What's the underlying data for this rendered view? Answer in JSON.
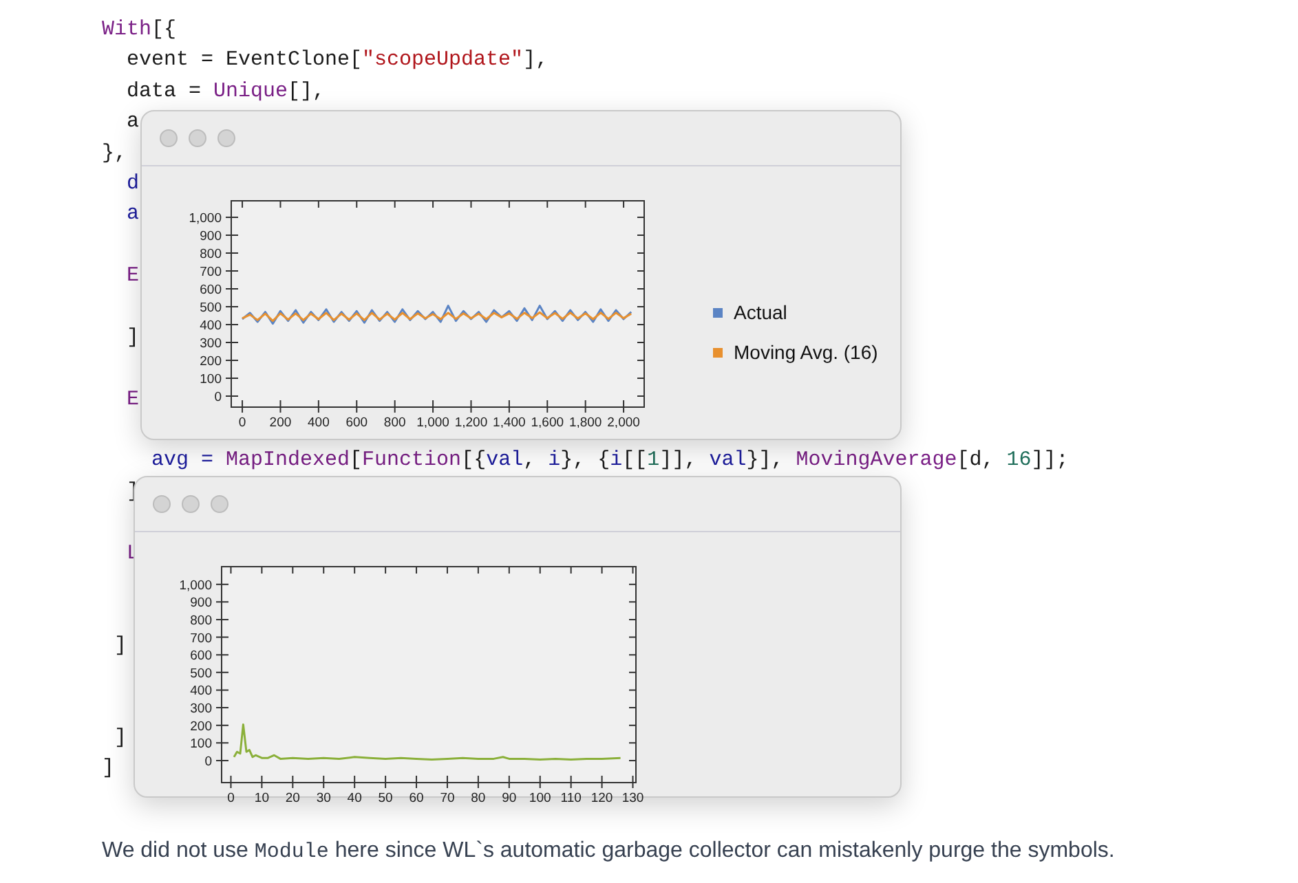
{
  "code_lines": [
    {
      "segments": [
        {
          "text": "With",
          "kind": "keyword"
        },
        {
          "text": "[{",
          "kind": "plain"
        }
      ]
    },
    {
      "segments": [
        {
          "text": "  event = EventClone[",
          "kind": "plain"
        },
        {
          "text": "\"scopeUpdate\"",
          "kind": "string"
        },
        {
          "text": "],",
          "kind": "plain"
        }
      ]
    },
    {
      "segments": [
        {
          "text": "  data = ",
          "kind": "plain"
        },
        {
          "text": "Unique",
          "kind": "keyword"
        },
        {
          "text": "[],",
          "kind": "plain"
        }
      ]
    },
    {
      "segments": [
        {
          "text": "  a",
          "kind": "plain"
        }
      ]
    },
    {
      "segments": [
        {
          "text": "},",
          "kind": "plain"
        }
      ]
    },
    {
      "segments": [
        {
          "text": "  d",
          "kind": "symbol"
        }
      ]
    },
    {
      "segments": [
        {
          "text": "  a",
          "kind": "symbol"
        }
      ]
    },
    {
      "segments": [
        {
          "text": "  E",
          "kind": "keyword"
        }
      ]
    },
    {
      "segments": [
        {
          "text": "  ]",
          "kind": "plain"
        }
      ]
    },
    {
      "segments": [
        {
          "text": "  E",
          "kind": "keyword"
        }
      ]
    },
    {
      "segments": [
        {
          "text": "    avg = ",
          "kind": "symbol"
        },
        {
          "text": "MapIndexed",
          "kind": "keyword"
        },
        {
          "text": "[",
          "kind": "plain"
        },
        {
          "text": "Function",
          "kind": "keyword"
        },
        {
          "text": "[{",
          "kind": "plain"
        },
        {
          "text": "val",
          "kind": "symbol"
        },
        {
          "text": ", ",
          "kind": "plain"
        },
        {
          "text": "i",
          "kind": "symbol"
        },
        {
          "text": "}, {",
          "kind": "plain"
        },
        {
          "text": "i",
          "kind": "symbol"
        },
        {
          "text": "[[",
          "kind": "plain"
        },
        {
          "text": "1",
          "kind": "number"
        },
        {
          "text": "]], ",
          "kind": "plain"
        },
        {
          "text": "val",
          "kind": "symbol"
        },
        {
          "text": "}], ",
          "kind": "plain"
        },
        {
          "text": "MovingAverage",
          "kind": "keyword"
        },
        {
          "text": "[d, ",
          "kind": "plain"
        },
        {
          "text": "16",
          "kind": "number"
        },
        {
          "text": "]];",
          "kind": "plain"
        }
      ]
    },
    {
      "segments": [
        {
          "text": "  ]",
          "kind": "plain"
        }
      ]
    },
    {
      "segments": [
        {
          "text": "  L",
          "kind": "keyword"
        }
      ]
    },
    {
      "segments": [
        {
          "text": " ]",
          "kind": "plain"
        }
      ]
    },
    {
      "segments": [
        {
          "text": " ]",
          "kind": "plain"
        }
      ]
    },
    {
      "segments": [
        {
          "text": "]",
          "kind": "plain"
        }
      ]
    }
  ],
  "windows": [
    {
      "chart_data": {
        "type": "line",
        "xlim": [
          -58,
          2108
        ],
        "ylim": [
          -62,
          1092
        ],
        "xticks": [
          {
            "value": 0,
            "label": "0"
          },
          {
            "value": 200,
            "label": "200"
          },
          {
            "value": 400,
            "label": "400"
          },
          {
            "value": 600,
            "label": "600"
          },
          {
            "value": 800,
            "label": "800"
          },
          {
            "value": 1000,
            "label": "1,000"
          },
          {
            "value": 1200,
            "label": "1,200"
          },
          {
            "value": 1400,
            "label": "1,400"
          },
          {
            "value": 1600,
            "label": "1,600"
          },
          {
            "value": 1800,
            "label": "1,800"
          },
          {
            "value": 2000,
            "label": "2,000"
          }
        ],
        "yticks": [
          {
            "value": 0,
            "label": "0"
          },
          {
            "value": 100,
            "label": "100"
          },
          {
            "value": 200,
            "label": "200"
          },
          {
            "value": 300,
            "label": "300"
          },
          {
            "value": 400,
            "label": "400"
          },
          {
            "value": 500,
            "label": "500"
          },
          {
            "value": 600,
            "label": "600"
          },
          {
            "value": 700,
            "label": "700"
          },
          {
            "value": 800,
            "label": "800"
          },
          {
            "value": 900,
            "label": "900"
          },
          {
            "value": 1000,
            "label": "1,000"
          }
        ],
        "x": [
          0,
          40,
          80,
          120,
          160,
          200,
          240,
          280,
          320,
          360,
          400,
          440,
          480,
          520,
          560,
          600,
          640,
          680,
          720,
          760,
          800,
          840,
          880,
          920,
          960,
          1000,
          1040,
          1080,
          1120,
          1160,
          1200,
          1240,
          1280,
          1320,
          1360,
          1400,
          1440,
          1480,
          1520,
          1560,
          1600,
          1640,
          1680,
          1720,
          1760,
          1800,
          1840,
          1880,
          1920,
          1960,
          2000,
          2040
        ],
        "series": [
          {
            "name": "Actual",
            "color": "#5b84c4",
            "values": [
              430,
              465,
              415,
              470,
              405,
              475,
              420,
              480,
              410,
              470,
              425,
              485,
              415,
              470,
              420,
              475,
              410,
              480,
              420,
              470,
              415,
              485,
              425,
              475,
              430,
              470,
              415,
              505,
              420,
              475,
              430,
              470,
              415,
              480,
              440,
              475,
              420,
              490,
              425,
              505,
              430,
              475,
              420,
              480,
              425,
              470,
              415,
              485,
              420,
              480,
              430,
              470
            ]
          },
          {
            "name": "Moving Avg. (16)",
            "color": "#e8902e",
            "values": [
              435,
              455,
              425,
              460,
              420,
              462,
              428,
              462,
              425,
              460,
              430,
              465,
              425,
              460,
              428,
              462,
              425,
              465,
              428,
              460,
              428,
              465,
              430,
              462,
              435,
              458,
              430,
              465,
              432,
              462,
              435,
              460,
              430,
              465,
              440,
              462,
              432,
              466,
              436,
              468,
              436,
              464,
              432,
              466,
              434,
              462,
              430,
              466,
              432,
              466,
              436,
              460
            ]
          }
        ]
      }
    },
    {
      "chart_data": {
        "type": "line",
        "xlim": [
          -3,
          131
        ],
        "ylim": [
          -125,
          1100
        ],
        "xticks": [
          0,
          10,
          20,
          30,
          40,
          50,
          60,
          70,
          80,
          90,
          100,
          110,
          120,
          130
        ],
        "yticks": [
          {
            "value": 0,
            "label": "0"
          },
          {
            "value": 100,
            "label": "100"
          },
          {
            "value": 200,
            "label": "200"
          },
          {
            "value": 300,
            "label": "300"
          },
          {
            "value": 400,
            "label": "400"
          },
          {
            "value": 500,
            "label": "500"
          },
          {
            "value": 600,
            "label": "600"
          },
          {
            "value": 700,
            "label": "700"
          },
          {
            "value": 800,
            "label": "800"
          },
          {
            "value": 900,
            "label": "900"
          },
          {
            "value": 1000,
            "label": "1,000"
          }
        ],
        "x": [
          1,
          2,
          3,
          4,
          5,
          6,
          7,
          8,
          10,
          12,
          14,
          16,
          20,
          25,
          30,
          35,
          40,
          45,
          50,
          55,
          60,
          65,
          70,
          75,
          80,
          85,
          88,
          90,
          95,
          100,
          105,
          110,
          115,
          120,
          126
        ],
        "series": [
          {
            "color": "#8bb03a",
            "values": [
              20,
              50,
              40,
              205,
              50,
              60,
              20,
              30,
              15,
              15,
              30,
              10,
              15,
              10,
              15,
              10,
              20,
              15,
              10,
              15,
              10,
              5,
              10,
              15,
              10,
              10,
              20,
              10,
              10,
              5,
              10,
              5,
              10,
              10,
              15
            ]
          }
        ]
      }
    }
  ],
  "paragraph": [
    {
      "text": "We did not use ",
      "kind": "plain"
    },
    {
      "text": "Module",
      "kind": "code"
    },
    {
      "text": " here since WL`s automatic garbage collector can mistakenly purge the symbols.",
      "kind": "plain"
    }
  ]
}
